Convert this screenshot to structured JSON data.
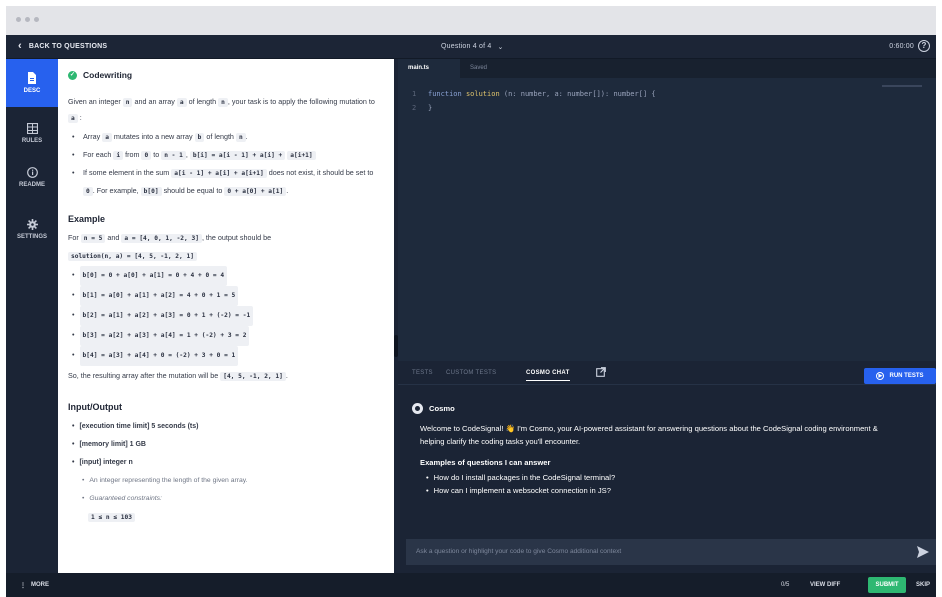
{
  "topbar": {
    "back_label": "BACK TO QUESTIONS",
    "question_selector": "Question 4 of 4",
    "timer": "0:60:00",
    "help_glyph": "?"
  },
  "leftnav": [
    {
      "label": "DESC",
      "icon": "document-icon"
    },
    {
      "label": "RULES",
      "icon": "rules-icon"
    },
    {
      "label": "README",
      "icon": "info-icon"
    },
    {
      "label": "SETTINGS",
      "icon": "gear-icon"
    }
  ],
  "desc": {
    "title": "Codewriting",
    "intro": [
      "Given an integer",
      "n",
      "and an array",
      "a",
      "of length",
      "n",
      ", your task is to apply the following mutation to",
      "a",
      ":"
    ],
    "bullet1": [
      "Array",
      "a",
      "mutates into a new array",
      "b",
      "of length",
      "n",
      "."
    ],
    "bullet2": [
      "For each",
      "i",
      "from",
      "0",
      "to",
      "n - 1",
      ",",
      "b[i] = a[i - 1] + a[i] +",
      "a[i+1]"
    ],
    "bullet3": [
      "If some element in the sum",
      "a[i - 1] + a[i] + a[i+1]",
      "does not exist, it should be set to",
      "0",
      ". For example,",
      "b[0]",
      "should be equal to",
      "0 + a[0] + a[1]",
      "."
    ],
    "example_heading": "Example",
    "example_intro": [
      "For",
      "n = 5",
      "and",
      "a = [4, 0, 1, -2, 3]",
      ", the output should be"
    ],
    "example_call": "solution(n, a) = [4, 5, -1, 2, 1]",
    "example_lines": [
      "b[0] = 0 + a[0] + a[1] = 0 + 4 + 0 = 4",
      "b[1] = a[0] + a[1] + a[2] = 4 + 0 + 1 = 5",
      "b[2] = a[1] + a[2] + a[3] = 0 + 1 + (-2) = -1",
      "b[3] = a[2] + a[3] + a[4] = 1 + (-2) + 3 = 2",
      "b[4] = a[3] + a[4] + 0 = (-2) + 3 + 0 = 1"
    ],
    "result": [
      "So, the resulting array after the mutation will be",
      "[4, 5, -1, 2, 1]",
      "."
    ],
    "io_heading": "Input/Output",
    "io": {
      "time": "[execution time limit] 5 seconds (ts)",
      "memory": "[memory limit] 1 GB",
      "input": "[input] integer n",
      "input_desc": "An integer representing the length of the given array.",
      "constraints_label": "Guaranteed constraints:",
      "constraint": "1 ≤ n ≤ 103"
    }
  },
  "editor": {
    "tabs": [
      "main.ts",
      "Saved"
    ],
    "lines": [
      {
        "num": "1",
        "kw": "function",
        "fn": "solution",
        "rest": "(n: number, a: number[]): number[] {"
      },
      {
        "num": "2",
        "kw": "",
        "fn": "",
        "rest": "}"
      }
    ]
  },
  "panel": {
    "tabs": [
      "TESTS",
      "CUSTOM TESTS",
      "COSMO CHAT"
    ],
    "run_label": "RUN TESTS",
    "cosmo_name": "Cosmo",
    "welcome_a": "Welcome to CodeSignal!",
    "wave": "👋",
    "welcome_b": "I'm Cosmo, your AI-powered assistant for answering questions about the CodeSignal coding environment & helping clarify the coding tasks you'll encounter.",
    "examples_heading": "Examples of questions I can answer",
    "examples": [
      "How do I install packages in the CodeSignal terminal?",
      "How can I implement a websocket connection in JS?"
    ],
    "chat_placeholder": "Ask a question or highlight your code to give Cosmo additional context"
  },
  "footer": {
    "more": "MORE",
    "count": "0/5",
    "view_diff": "VIEW DIFF",
    "submit": "SUBMIT",
    "skip": "SKIP"
  }
}
